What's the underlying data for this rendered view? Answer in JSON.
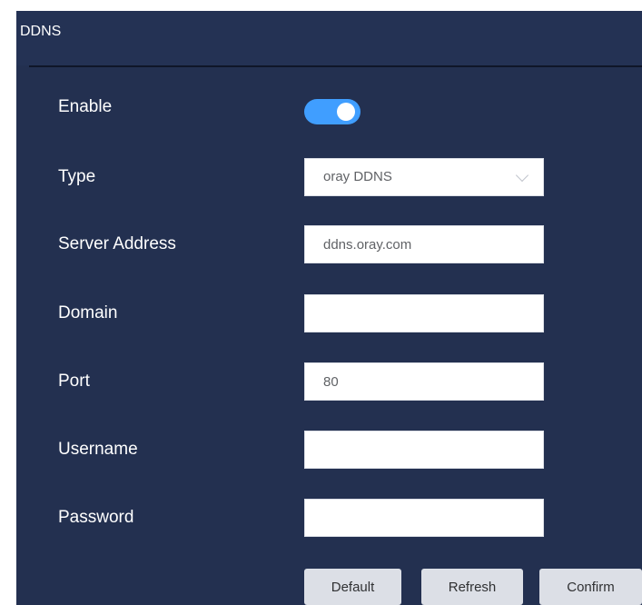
{
  "section": {
    "title": "DDNS"
  },
  "form": {
    "enable": {
      "label": "Enable",
      "on": true
    },
    "type": {
      "label": "Type",
      "value": "oray DDNS"
    },
    "server_address": {
      "label": "Server Address",
      "value": "ddns.oray.com"
    },
    "domain": {
      "label": "Domain",
      "value": ""
    },
    "port": {
      "label": "Port",
      "value": "80"
    },
    "username": {
      "label": "Username",
      "value": ""
    },
    "password": {
      "label": "Password",
      "value": ""
    }
  },
  "buttons": {
    "default": "Default",
    "refresh": "Refresh",
    "confirm": "Confirm"
  },
  "colors": {
    "panel_background": "#233050",
    "toggle_on": "#409eff",
    "button_background": "#dcdfe6"
  }
}
